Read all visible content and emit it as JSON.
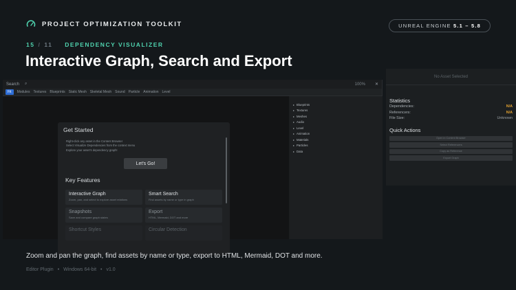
{
  "brand": {
    "name": "PROJECT OPTIMIZATION TOOLKIT",
    "icon": "gauge-icon"
  },
  "engine": {
    "label": "UNREAL ENGINE",
    "version": "5.1 – 5.8"
  },
  "step": {
    "current": "15",
    "total": "11",
    "label": "DEPENDENCY VISUALIZER"
  },
  "headline": "Interactive Graph, Search and Export",
  "editor": {
    "search_label": "Search",
    "zoom": "100%",
    "close": "✕",
    "toolbar": [
      "Fit",
      "Modules",
      "Textures",
      "Blueprints",
      "Static Mesh",
      "Skeletal Mesh",
      "Sound",
      "Particle",
      "Animation",
      "Level"
    ],
    "panel_items": [
      "Blueprints",
      "Textures",
      "Meshes",
      "Audio",
      "Level",
      "Animation",
      "Materials",
      "Particles",
      "Data"
    ],
    "get_started": {
      "title": "Get Started",
      "desc": [
        "Right-click any asset in the Content Browser",
        "Select Visualize Dependencies from the context menu",
        "Explore your asset's dependency graph!"
      ],
      "button": "Let's Go!"
    },
    "key_features": {
      "title": "Key Features",
      "cards": [
        {
          "title": "Interactive Graph",
          "desc": "Zoom, pan, and select to explore asset relations"
        },
        {
          "title": "Smart Search",
          "desc": "Find assets by name or type in graph"
        },
        {
          "title": "Snapshots",
          "desc": "Save and compare graph states"
        },
        {
          "title": "Export",
          "desc": "HTML, Mermaid, DOT and more"
        },
        {
          "title": "Shortcut Styles",
          "desc": ""
        },
        {
          "title": "Circular Detection",
          "desc": ""
        }
      ]
    }
  },
  "inspector": {
    "top": "No Asset Selected",
    "stats_title": "Statistics",
    "stats": [
      {
        "label": "Dependencies:",
        "value": "N/A",
        "kind": "warn"
      },
      {
        "label": "Referencers:",
        "value": "N/A",
        "kind": "warn"
      },
      {
        "label": "File Size:",
        "value": "Unknown",
        "kind": "muted"
      }
    ],
    "qa_title": "Quick Actions",
    "actions": [
      "Open in Content Browser",
      "Select Referencers",
      "Copy as Reference",
      "Export Graph"
    ]
  },
  "caption": "Zoom and pan the graph, find assets by name or type, export to HTML, Mermaid, DOT and more.",
  "meta": [
    "Editor Plugin",
    "Windows 64-bit",
    "v1.0"
  ],
  "colors": {
    "accent": "#4fd2ae",
    "warn": "#e0a030",
    "toolbar_active": "#2f6ed6"
  }
}
